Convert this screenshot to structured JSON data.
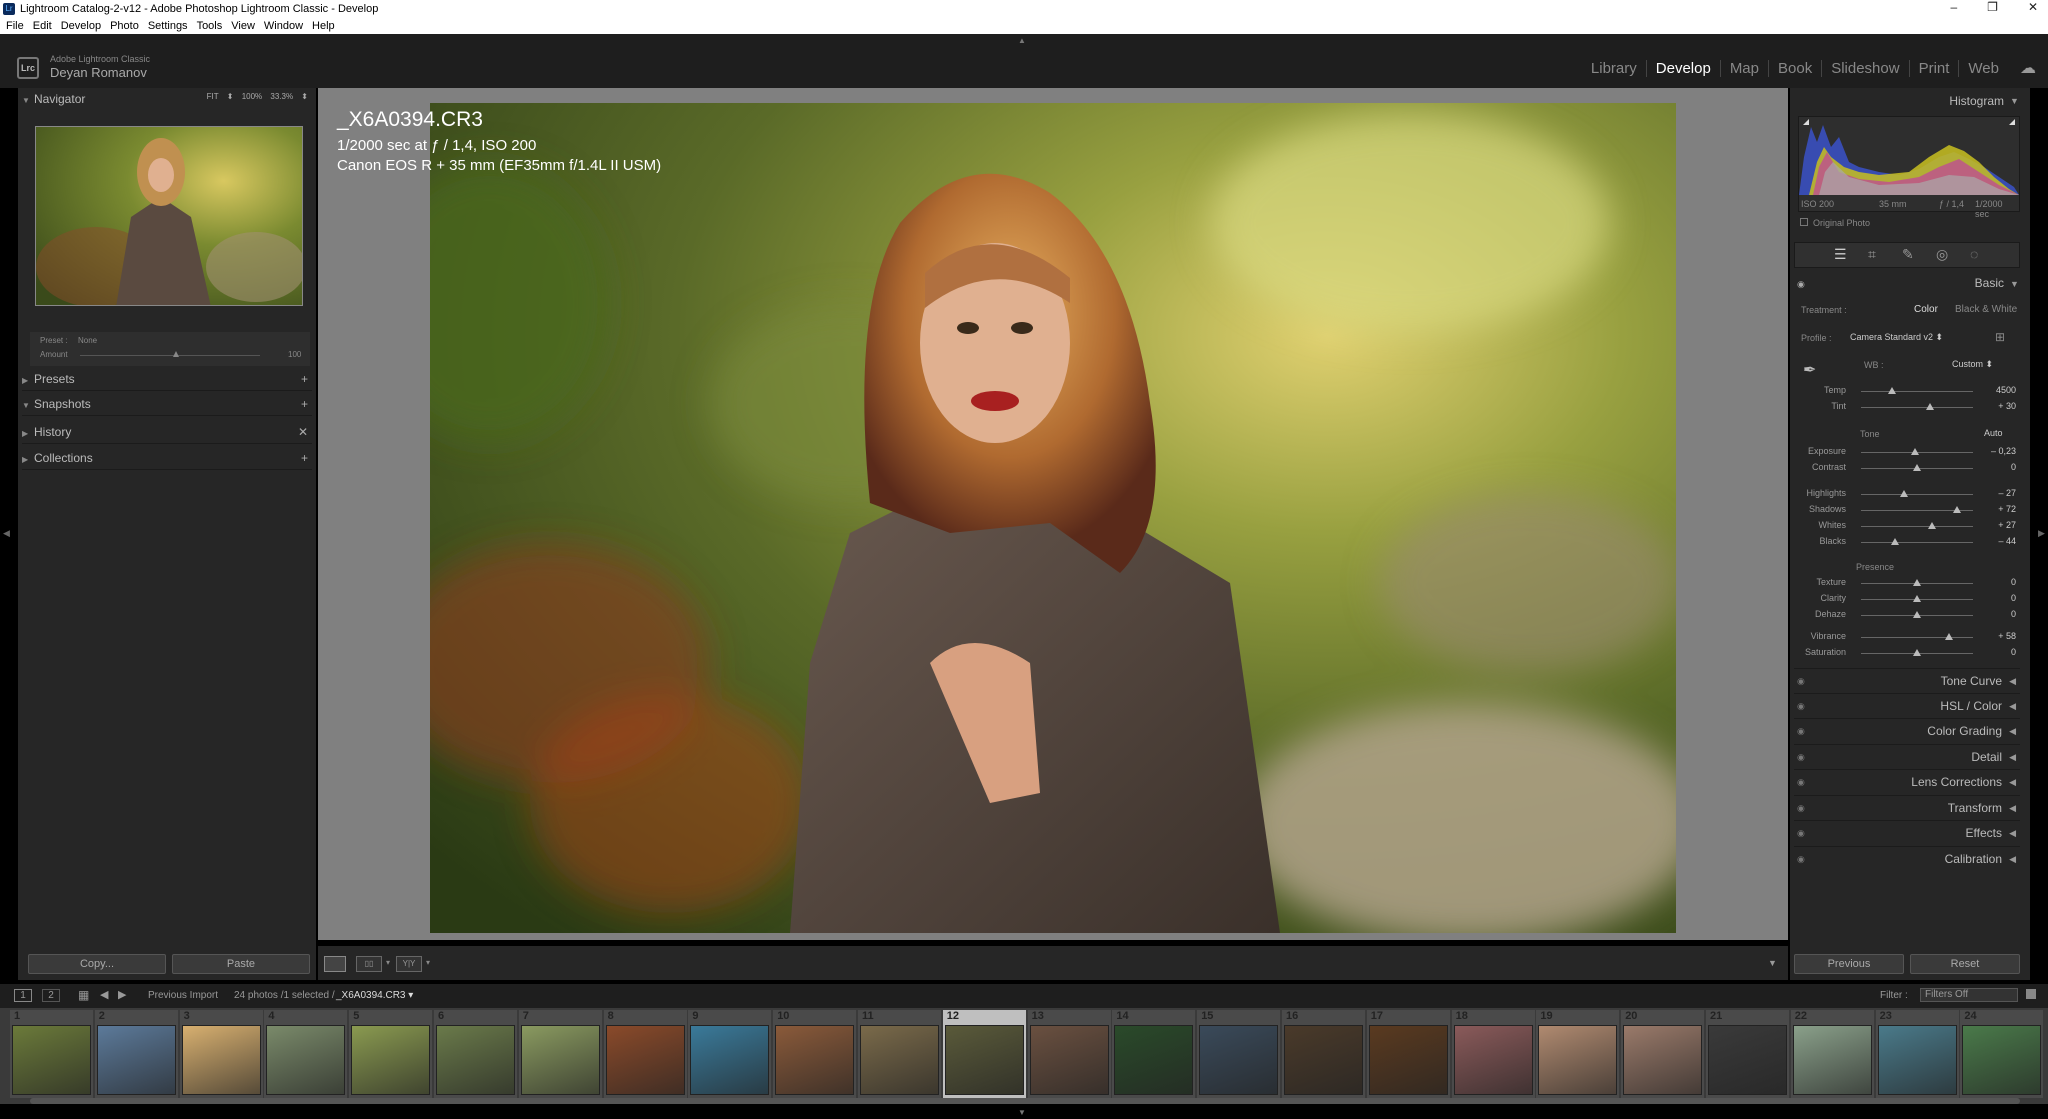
{
  "window": {
    "title": "Lightroom Catalog-2-v12 - Adobe Photoshop Lightroom Classic - Develop",
    "controls": [
      "–",
      "❐",
      "✕"
    ]
  },
  "menu": [
    "File",
    "Edit",
    "Develop",
    "Photo",
    "Settings",
    "Tools",
    "View",
    "Window",
    "Help"
  ],
  "identity": {
    "logo": "Lrc",
    "product": "Adobe Lightroom Classic",
    "user": "Deyan Romanov"
  },
  "modules": [
    "Library",
    "Develop",
    "Map",
    "Book",
    "Slideshow",
    "Print",
    "Web"
  ],
  "active_module": "Develop",
  "navigator": {
    "title": "Navigator",
    "fit": "FIT ⬍",
    "z100": "100%",
    "z333": "33.3% ⬍"
  },
  "preset": {
    "label": "Preset :",
    "value": "None",
    "amount_label": "Amount",
    "amount_value": "100"
  },
  "left_sections": [
    {
      "label": "Presets",
      "action": "+"
    },
    {
      "label": "Snapshots",
      "action": "+"
    },
    {
      "label": "History",
      "action": "✕"
    },
    {
      "label": "Collections",
      "action": "+"
    }
  ],
  "left_buttons": {
    "copy": "Copy...",
    "paste": "Paste"
  },
  "photo_info": {
    "filename": "_X6A0394.CR3",
    "exposure": "1/2000 sec at ƒ / 1,4, ISO 200",
    "camera": "Canon EOS R + 35 mm (EF35mm f/1.4L II USM)"
  },
  "histogram": {
    "title": "Histogram",
    "iso": "ISO 200",
    "focal": "35 mm",
    "aperture": "ƒ / 1,4",
    "shutter": "1/2000 sec",
    "original_photo": "Original Photo"
  },
  "basic": {
    "title": "Basic",
    "treatment_label": "Treatment :",
    "treatment_color": "Color",
    "treatment_bw": "Black & White",
    "profile_label": "Profile :",
    "profile_value": "Camera Standard v2 ⬍",
    "wb_label": "WB :",
    "wb_value": "Custom ⬍",
    "tone_label": "Tone",
    "auto_label": "Auto",
    "presence_label": "Presence",
    "sliders": [
      {
        "name": "Temp",
        "value": "4500",
        "pos": 0.28
      },
      {
        "name": "Tint",
        "value": "+ 30",
        "pos": 0.62
      },
      {
        "name": "Exposure",
        "value": "– 0,23",
        "pos": 0.48
      },
      {
        "name": "Contrast",
        "value": "0",
        "pos": 0.5
      },
      {
        "name": "Highlights",
        "value": "– 27",
        "pos": 0.38
      },
      {
        "name": "Shadows",
        "value": "+ 72",
        "pos": 0.86
      },
      {
        "name": "Whites",
        "value": "+ 27",
        "pos": 0.63
      },
      {
        "name": "Blacks",
        "value": "– 44",
        "pos": 0.3
      },
      {
        "name": "Texture",
        "value": "0",
        "pos": 0.5
      },
      {
        "name": "Clarity",
        "value": "0",
        "pos": 0.5
      },
      {
        "name": "Dehaze",
        "value": "0",
        "pos": 0.5
      },
      {
        "name": "Vibrance",
        "value": "+ 58",
        "pos": 0.79
      },
      {
        "name": "Saturation",
        "value": "0",
        "pos": 0.5
      }
    ]
  },
  "right_sections": [
    "Tone Curve",
    "HSL / Color",
    "Color Grading",
    "Detail",
    "Lens Corrections",
    "Transform",
    "Effects",
    "Calibration"
  ],
  "right_buttons": {
    "previous": "Previous",
    "reset": "Reset"
  },
  "filmstrip_bar": {
    "p1": "1",
    "p2": "2",
    "source": "Previous Import",
    "count": "24 photos /1 selected /",
    "selected_file": "_X6A0394.CR3 ▾",
    "filter_label": "Filter :",
    "filter_value": "Filters Off"
  },
  "filmstrip": [
    {
      "n": "1",
      "c": "#6b7a3a"
    },
    {
      "n": "2",
      "c": "#5c7a9a"
    },
    {
      "n": "3",
      "c": "#d8b070"
    },
    {
      "n": "4",
      "c": "#7a8a6a"
    },
    {
      "n": "5",
      "c": "#8a9a50"
    },
    {
      "n": "6",
      "c": "#6a7a4a"
    },
    {
      "n": "7",
      "c": "#8a9a60"
    },
    {
      "n": "8",
      "c": "#8a4a2a"
    },
    {
      "n": "9",
      "c": "#3a7a9a"
    },
    {
      "n": "10",
      "c": "#8a5a3a"
    },
    {
      "n": "11",
      "c": "#7a6a4a"
    },
    {
      "n": "12",
      "c": "#5a5a3a"
    },
    {
      "n": "13",
      "c": "#6a5040"
    },
    {
      "n": "14",
      "c": "#2a4a2a"
    },
    {
      "n": "15",
      "c": "#3a4a5a"
    },
    {
      "n": "16",
      "c": "#4a3a2a"
    },
    {
      "n": "17",
      "c": "#5a3a20"
    },
    {
      "n": "18",
      "c": "#8a5a5a"
    },
    {
      "n": "19",
      "c": "#b08a70"
    },
    {
      "n": "20",
      "c": "#9a7a6a"
    },
    {
      "n": "21",
      "c": "#3a3a3a"
    },
    {
      "n": "22",
      "c": "#8aa08a"
    },
    {
      "n": "23",
      "c": "#4a7a8a"
    },
    {
      "n": "24",
      "c": "#4a7a4a"
    }
  ],
  "selected_index": 11
}
